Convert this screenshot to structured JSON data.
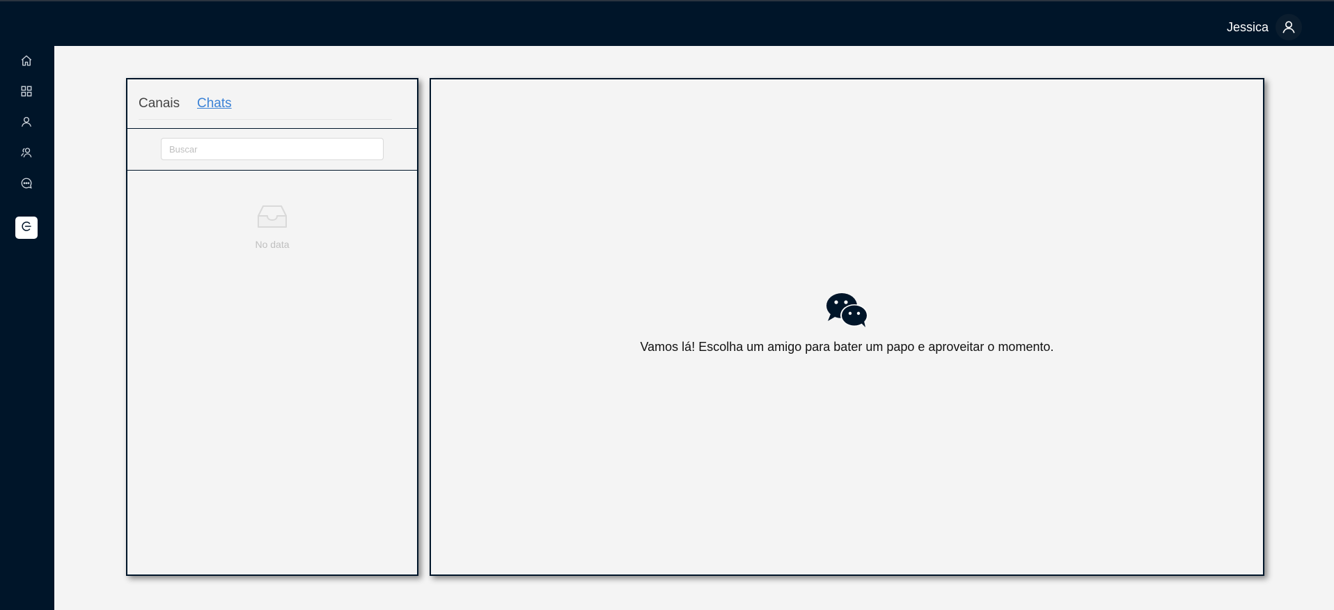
{
  "header": {
    "user_name": "Jessica",
    "avatar_icon": "user-icon"
  },
  "sidebar": {
    "items": [
      {
        "icon": "home-icon",
        "active": false
      },
      {
        "icon": "apps-grid-icon",
        "active": false
      },
      {
        "icon": "user-icon",
        "active": false
      },
      {
        "icon": "users-icon",
        "active": false
      },
      {
        "icon": "chat-bubble-icon",
        "active": false
      },
      {
        "icon": "logout-icon",
        "active": true
      }
    ]
  },
  "left_panel": {
    "tabs": [
      {
        "label": "Canais",
        "active": false
      },
      {
        "label": "Chats",
        "active": true
      }
    ],
    "search": {
      "placeholder": "Buscar",
      "value": ""
    },
    "empty": {
      "icon": "empty-inbox-icon",
      "text": "No data"
    }
  },
  "right_panel": {
    "icon": "wechat-icon",
    "message": "Vamos lá! Escolha um amigo para bater um papo e aproveitar o momento."
  },
  "colors": {
    "nav_background": "#001529",
    "content_background": "#f4f4f4",
    "active_tab": "#3b82d6"
  }
}
